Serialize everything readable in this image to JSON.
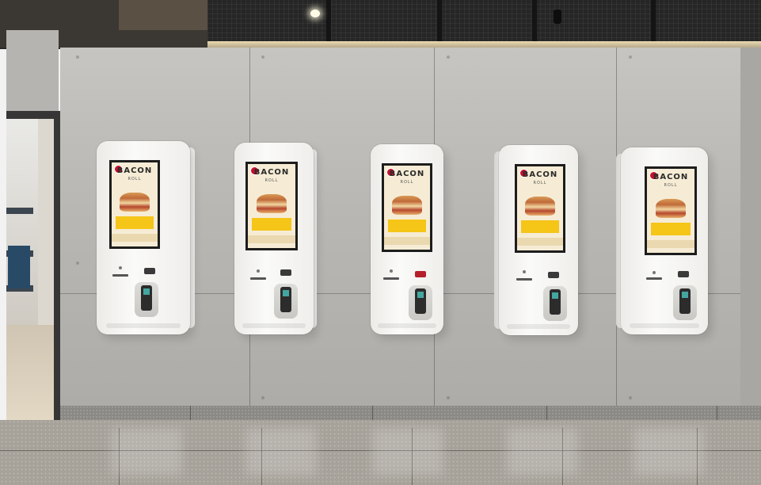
{
  "scene": {
    "kiosk_count": 5,
    "colors": {
      "wall": "#b9b7b3",
      "ceiling": "#2a2a2a",
      "kiosk": "#f5f5f3",
      "promo_background": "#f6ecd5",
      "promo_yellow": "#f5c518",
      "brand_red": "#c8102e"
    }
  },
  "kiosks": [
    {
      "promo_title": "BACON",
      "promo_subtitle": "ROLL",
      "printer_color": "#3a3a3a"
    },
    {
      "promo_title": "BACON",
      "promo_subtitle": "ROLL",
      "printer_color": "#3a3a3a"
    },
    {
      "promo_title": "BACON",
      "promo_subtitle": "ROLL",
      "printer_color": "#b51f2b"
    },
    {
      "promo_title": "BACON",
      "promo_subtitle": "ROLL",
      "printer_color": "#3a3a3a"
    },
    {
      "promo_title": "BACON",
      "promo_subtitle": "ROLL",
      "printer_color": "#3a3a3a"
    }
  ]
}
